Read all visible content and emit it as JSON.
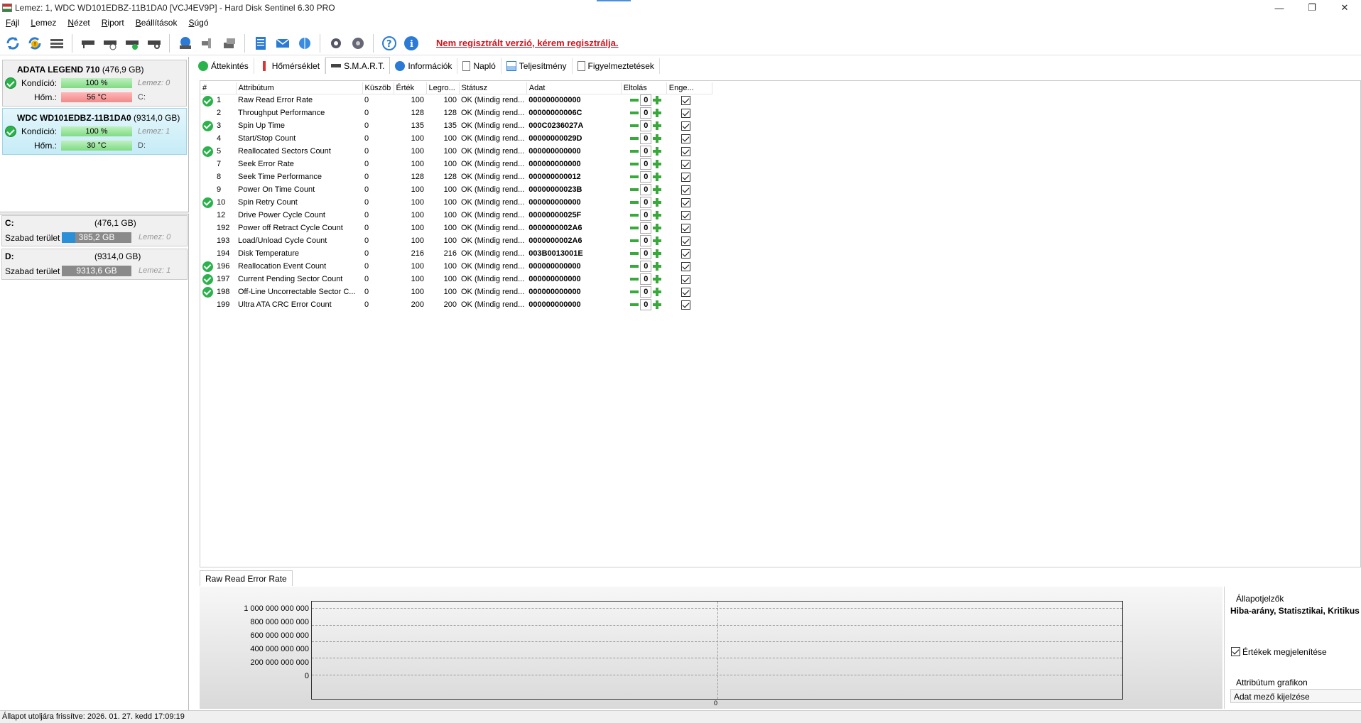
{
  "window": {
    "title": "Lemez: 1, WDC WD101EDBZ-11B1DA0 [VCJ4EV9P]  -  Hard Disk Sentinel 6.30 PRO"
  },
  "menu": [
    {
      "pre": "",
      "u": "F",
      "post": "ájl"
    },
    {
      "pre": "",
      "u": "L",
      "post": "emez"
    },
    {
      "pre": "",
      "u": "N",
      "post": "ézet"
    },
    {
      "pre": "",
      "u": "R",
      "post": "iport"
    },
    {
      "pre": "",
      "u": "B",
      "post": "eállítások"
    },
    {
      "pre": "",
      "u": "S",
      "post": "úgó"
    }
  ],
  "toolbar": {
    "register_notice": "Nem regisztrált verzió, kérem regisztrálja."
  },
  "disks": [
    {
      "name": "ADATA LEGEND 710",
      "size": "(476,9 GB)",
      "condition_label": "Kondíció:",
      "condition": "100 %",
      "condition_pct": 100,
      "temp_label": "Hőm.:",
      "temp": "56 °C",
      "disk_ref": "Lemez: 0",
      "drive": "C:"
    },
    {
      "name": "WDC WD101EDBZ-11B1DA0",
      "size": "(9314,0 GB)",
      "condition_label": "Kondíció:",
      "condition": "100 %",
      "condition_pct": 100,
      "temp_label": "Hőm.:",
      "temp": "30 °C",
      "disk_ref": "Lemez: 1",
      "drive": "D:"
    }
  ],
  "volumes": [
    {
      "letter": "C:",
      "size": "(476,1 GB)",
      "free_label": "Szabad terület",
      "free": "385,2 GB",
      "free_pct": 81,
      "disk_ref": "Lemez: 0"
    },
    {
      "letter": "D:",
      "size": "(9314,0 GB)",
      "free_label": "Szabad terület",
      "free": "9313,6 GB",
      "free_pct": 100,
      "disk_ref": "Lemez: 1"
    }
  ],
  "tabs": [
    "Áttekintés",
    "Hőmérséklet",
    "S.M.A.R.T.",
    "Információk",
    "Napló",
    "Teljesítmény",
    "Figyelmeztetések"
  ],
  "smart": {
    "headers": [
      "#",
      "Attribútum",
      "Küszöb",
      "Érték",
      "Legro...",
      "Státusz",
      "Adat",
      "Eltolás",
      "Enge..."
    ],
    "rows": [
      {
        "ok": true,
        "id": "1",
        "name": "Raw Read Error Rate",
        "threshold": "0",
        "value": "100",
        "worst": "100",
        "status": "OK (Mindig rend...",
        "data": "000000000000",
        "offset": "0"
      },
      {
        "ok": false,
        "id": "2",
        "name": "Throughput Performance",
        "threshold": "0",
        "value": "128",
        "worst": "128",
        "status": "OK (Mindig rend...",
        "data": "00000000006C",
        "offset": "0"
      },
      {
        "ok": true,
        "id": "3",
        "name": "Spin Up Time",
        "threshold": "0",
        "value": "135",
        "worst": "135",
        "status": "OK (Mindig rend...",
        "data": "000C0236027A",
        "offset": "0"
      },
      {
        "ok": false,
        "id": "4",
        "name": "Start/Stop Count",
        "threshold": "0",
        "value": "100",
        "worst": "100",
        "status": "OK (Mindig rend...",
        "data": "00000000029D",
        "offset": "0"
      },
      {
        "ok": true,
        "id": "5",
        "name": "Reallocated Sectors Count",
        "threshold": "0",
        "value": "100",
        "worst": "100",
        "status": "OK (Mindig rend...",
        "data": "000000000000",
        "offset": "0"
      },
      {
        "ok": false,
        "id": "7",
        "name": "Seek Error Rate",
        "threshold": "0",
        "value": "100",
        "worst": "100",
        "status": "OK (Mindig rend...",
        "data": "000000000000",
        "offset": "0"
      },
      {
        "ok": false,
        "id": "8",
        "name": "Seek Time Performance",
        "threshold": "0",
        "value": "128",
        "worst": "128",
        "status": "OK (Mindig rend...",
        "data": "000000000012",
        "offset": "0"
      },
      {
        "ok": false,
        "id": "9",
        "name": "Power On Time Count",
        "threshold": "0",
        "value": "100",
        "worst": "100",
        "status": "OK (Mindig rend...",
        "data": "00000000023B",
        "offset": "0"
      },
      {
        "ok": true,
        "id": "10",
        "name": "Spin Retry Count",
        "threshold": "0",
        "value": "100",
        "worst": "100",
        "status": "OK (Mindig rend...",
        "data": "000000000000",
        "offset": "0"
      },
      {
        "ok": false,
        "id": "12",
        "name": "Drive Power Cycle Count",
        "threshold": "0",
        "value": "100",
        "worst": "100",
        "status": "OK (Mindig rend...",
        "data": "00000000025F",
        "offset": "0"
      },
      {
        "ok": false,
        "id": "192",
        "name": "Power off Retract Cycle Count",
        "threshold": "0",
        "value": "100",
        "worst": "100",
        "status": "OK (Mindig rend...",
        "data": "0000000002A6",
        "offset": "0"
      },
      {
        "ok": false,
        "id": "193",
        "name": "Load/Unload Cycle Count",
        "threshold": "0",
        "value": "100",
        "worst": "100",
        "status": "OK (Mindig rend...",
        "data": "0000000002A6",
        "offset": "0"
      },
      {
        "ok": false,
        "id": "194",
        "name": "Disk Temperature",
        "threshold": "0",
        "value": "216",
        "worst": "216",
        "status": "OK (Mindig rend...",
        "data": "003B0013001E",
        "offset": "0"
      },
      {
        "ok": true,
        "id": "196",
        "name": "Reallocation Event Count",
        "threshold": "0",
        "value": "100",
        "worst": "100",
        "status": "OK (Mindig rend...",
        "data": "000000000000",
        "offset": "0"
      },
      {
        "ok": true,
        "id": "197",
        "name": "Current Pending Sector Count",
        "threshold": "0",
        "value": "100",
        "worst": "100",
        "status": "OK (Mindig rend...",
        "data": "000000000000",
        "offset": "0"
      },
      {
        "ok": true,
        "id": "198",
        "name": "Off-Line Uncorrectable Sector C...",
        "threshold": "0",
        "value": "100",
        "worst": "100",
        "status": "OK (Mindig rend...",
        "data": "000000000000",
        "offset": "0"
      },
      {
        "ok": false,
        "id": "199",
        "name": "Ultra ATA CRC Error Count",
        "threshold": "0",
        "value": "200",
        "worst": "200",
        "status": "OK (Mindig rend...",
        "data": "000000000000",
        "offset": "0"
      }
    ]
  },
  "graph": {
    "tab": "Raw Read Error Rate",
    "y_labels": [
      "1 000 000 000 000",
      "800 000 000 000",
      "600 000 000 000",
      "400 000 000 000",
      "200 000 000 000",
      "0"
    ],
    "x_marker": "0"
  },
  "graph_panel": {
    "title": "Állapotjelzők",
    "types": "Hiba-arány, Statisztikai, Kritikus",
    "show_values": "Értékek megjelenítése",
    "attr_graph_label": "Attribútum grafikon",
    "attr_graph_value": "Adat mező kijelzése"
  },
  "statusbar": {
    "text": "Állapot utoljára frissítve: 2026. 01. 27. kedd 17:09:19"
  },
  "colors": {
    "ok": "#2bb24c",
    "register": "#d4121c",
    "selection": "#c6ecf7",
    "free_bar": "#2a8fd6"
  }
}
